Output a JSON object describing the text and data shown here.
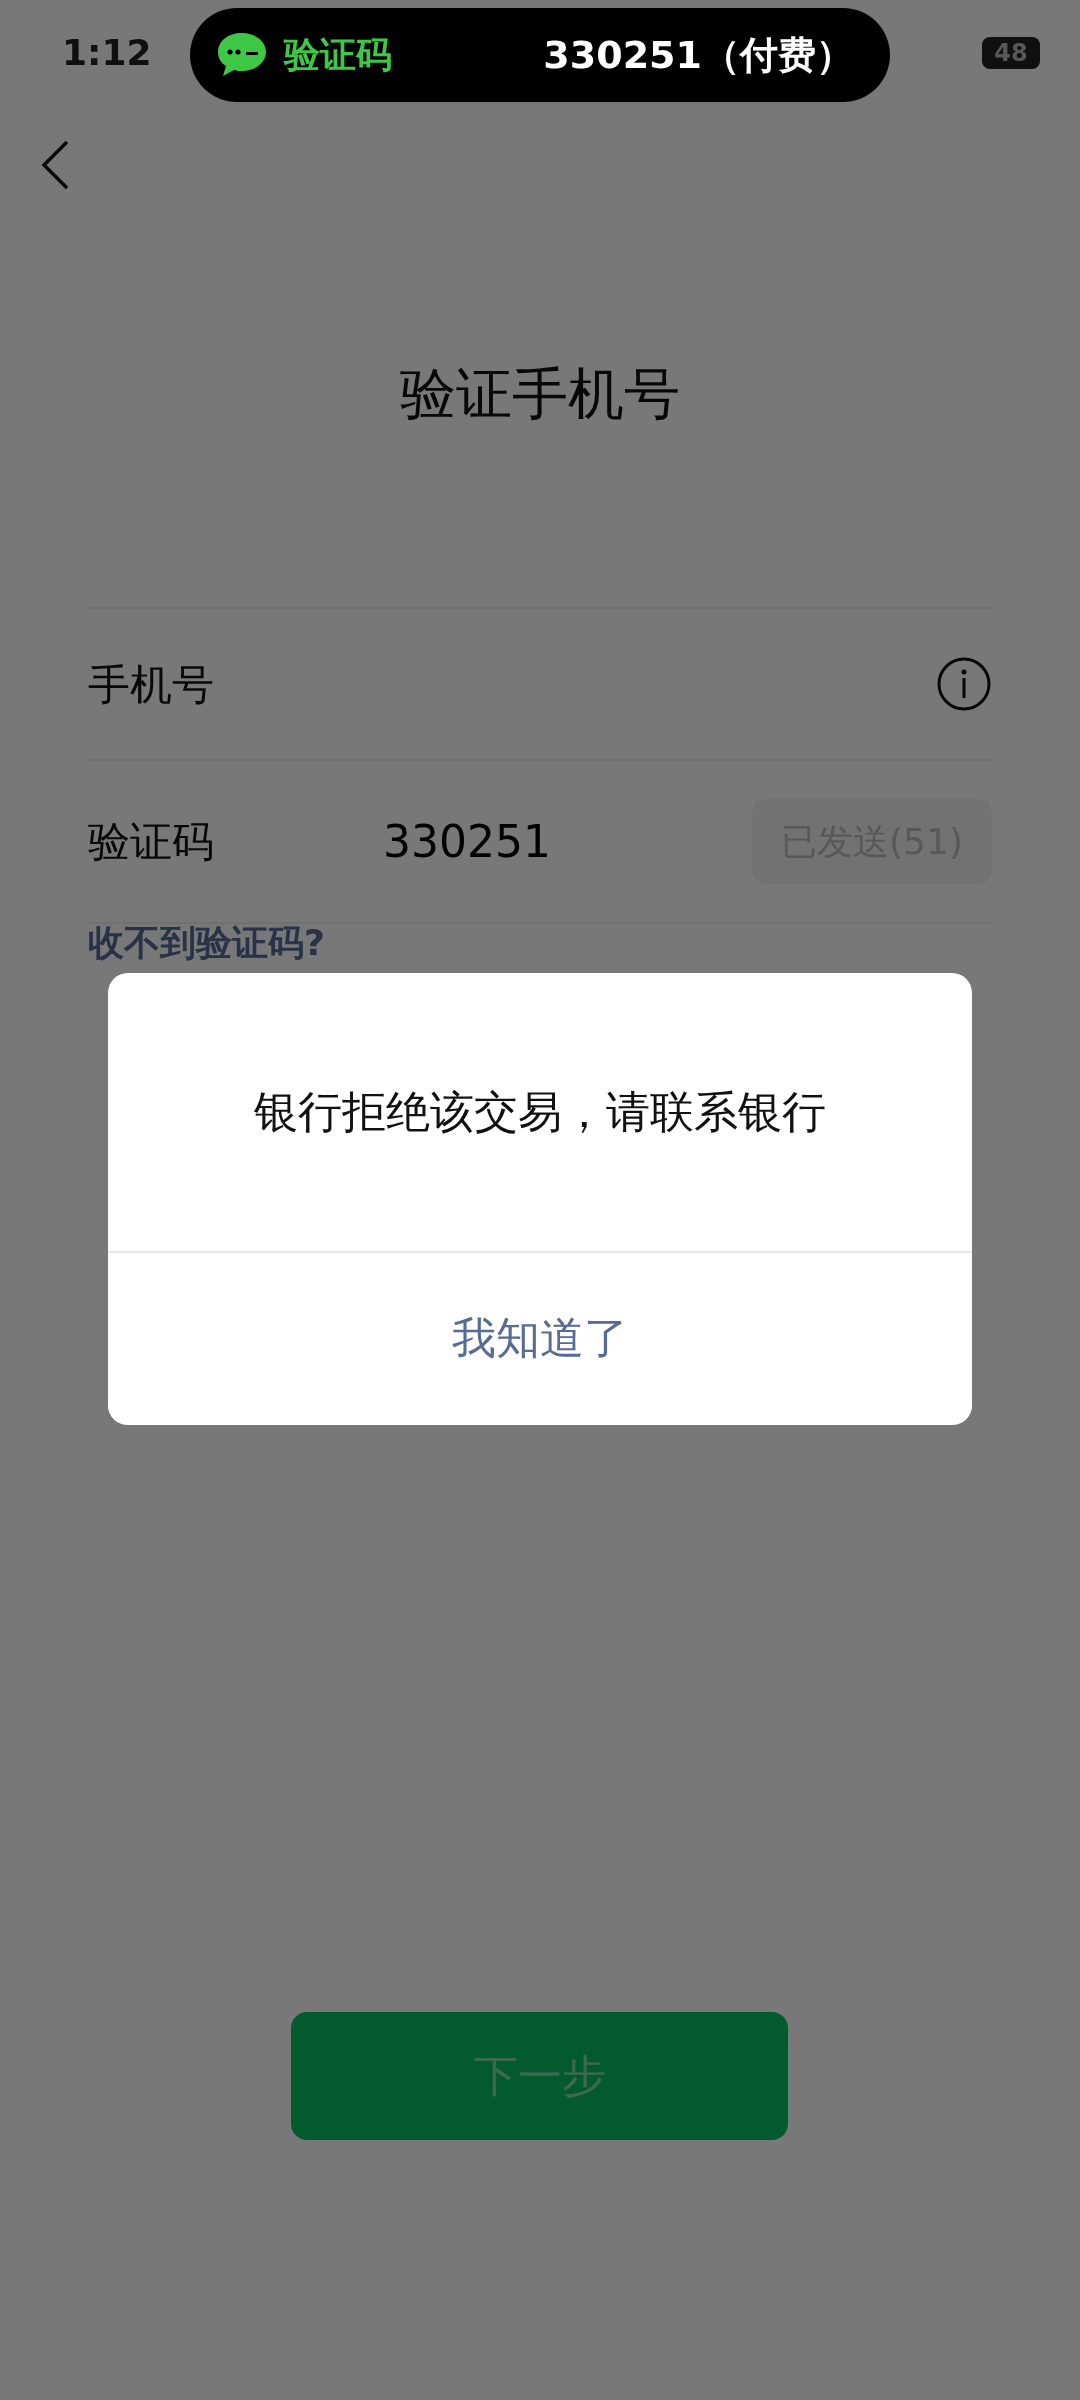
{
  "status_bar": {
    "time": "1:12",
    "battery": "48"
  },
  "notification": {
    "app": "验证码",
    "text": "330251（付费）"
  },
  "page": {
    "title": "验证手机号"
  },
  "fields": [
    {
      "label": "手机号",
      "kind": "phone"
    },
    {
      "label": "验证码",
      "value": "330251",
      "kind": "code",
      "resend": "已发送(51)",
      "resend_disabled": true
    }
  ],
  "help_link": "收不到验证码?",
  "next_button": {
    "label": "下一步",
    "disabled": true
  },
  "dialog": {
    "message": "银行拒绝该交易，请联系银行",
    "button": "我知道了"
  }
}
